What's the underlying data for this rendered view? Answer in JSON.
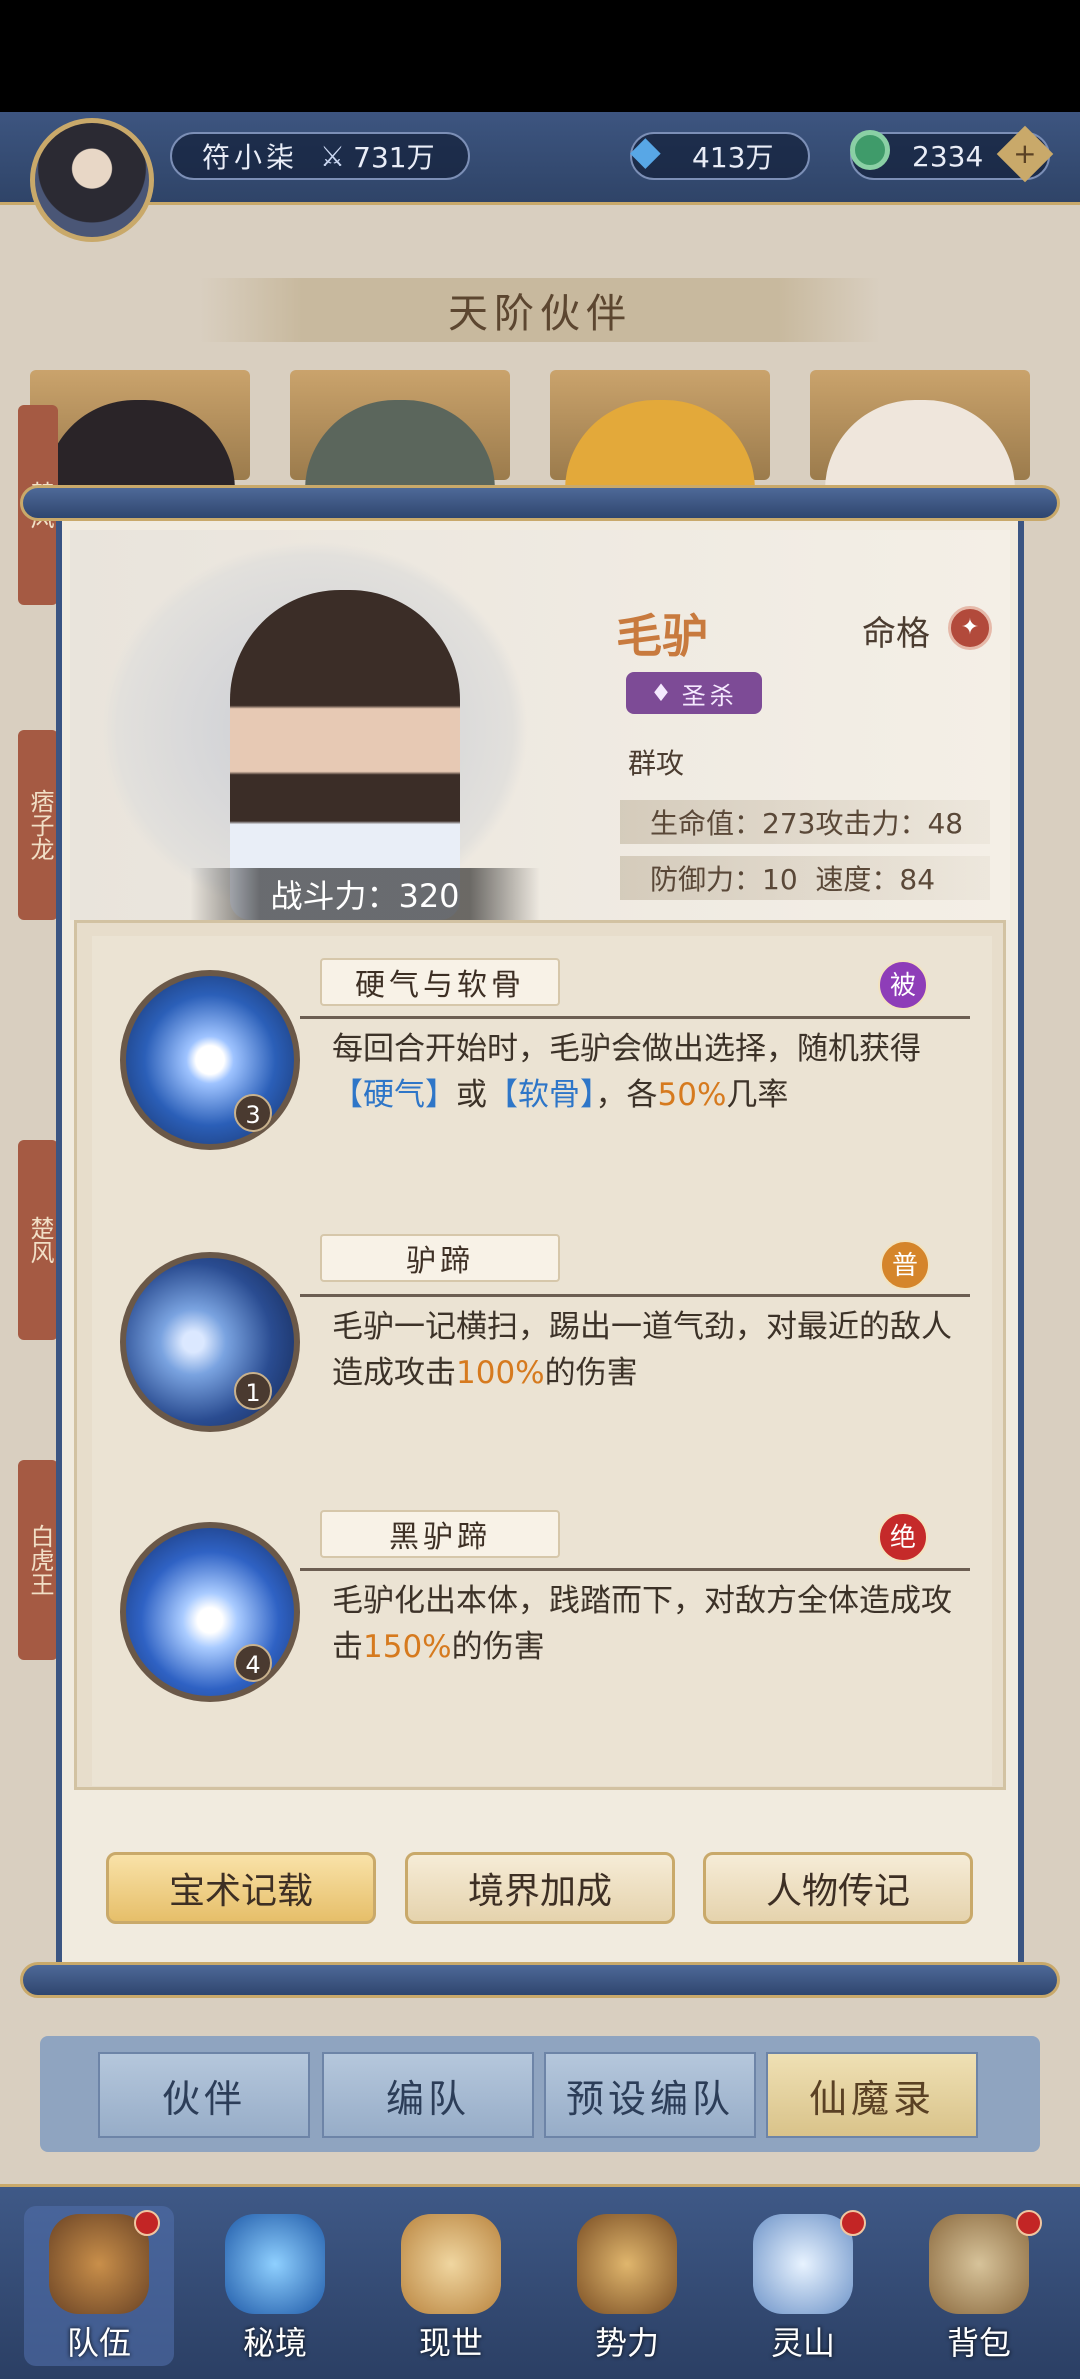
{
  "header": {
    "player_name": "符小柒",
    "combat_power": "731万",
    "gem_count": "413万",
    "jade_count": "2334"
  },
  "banner": {
    "title": "天阶伙伴"
  },
  "side_tags": [
    "楚风",
    "痞子龙",
    "楚风",
    "白虎王"
  ],
  "character": {
    "name": "毛驴",
    "fate_label": "命格",
    "rank": "圣杀",
    "role": "群攻",
    "power_text": "战斗力：320",
    "stats_row1": "生命值：273攻击力：48",
    "stats_row2": "防御力：10  速度：84"
  },
  "skills": [
    {
      "name": "硬气与软骨",
      "level": "3",
      "tag": "被",
      "tag_color": "#8e3db8",
      "desc_a": "每回合开始时，毛驴会做出选择，随机获得",
      "hl1": "【硬气】",
      "mid": "或",
      "hl2": "【软骨】",
      "tail": "，各",
      "pct": "50%",
      "end": "几率"
    },
    {
      "name": "驴蹄",
      "level": "1",
      "tag": "普",
      "tag_color": "#d5852a",
      "desc_a": "毛驴一记横扫，踢出一道气劲，对最近的敌人造成攻击",
      "pct": "100%",
      "end": "的伤害"
    },
    {
      "name": "黑驴蹄",
      "level": "4",
      "tag": "绝",
      "tag_color": "#c52a2a",
      "desc_a": "毛驴化出本体，践踏而下，对敌方全体造成攻击",
      "pct": "150%",
      "end": "的伤害"
    }
  ],
  "scroll_buttons": [
    "宝术记载",
    "境界加成",
    "人物传记"
  ],
  "tabs": [
    "伙伴",
    "编队",
    "预设编队",
    "仙魔录"
  ],
  "nav": [
    "队伍",
    "秘境",
    "现世",
    "势力",
    "灵山",
    "背包"
  ],
  "colors": {
    "accent_gold": "#c9a96a",
    "navy": "#3b5582"
  }
}
